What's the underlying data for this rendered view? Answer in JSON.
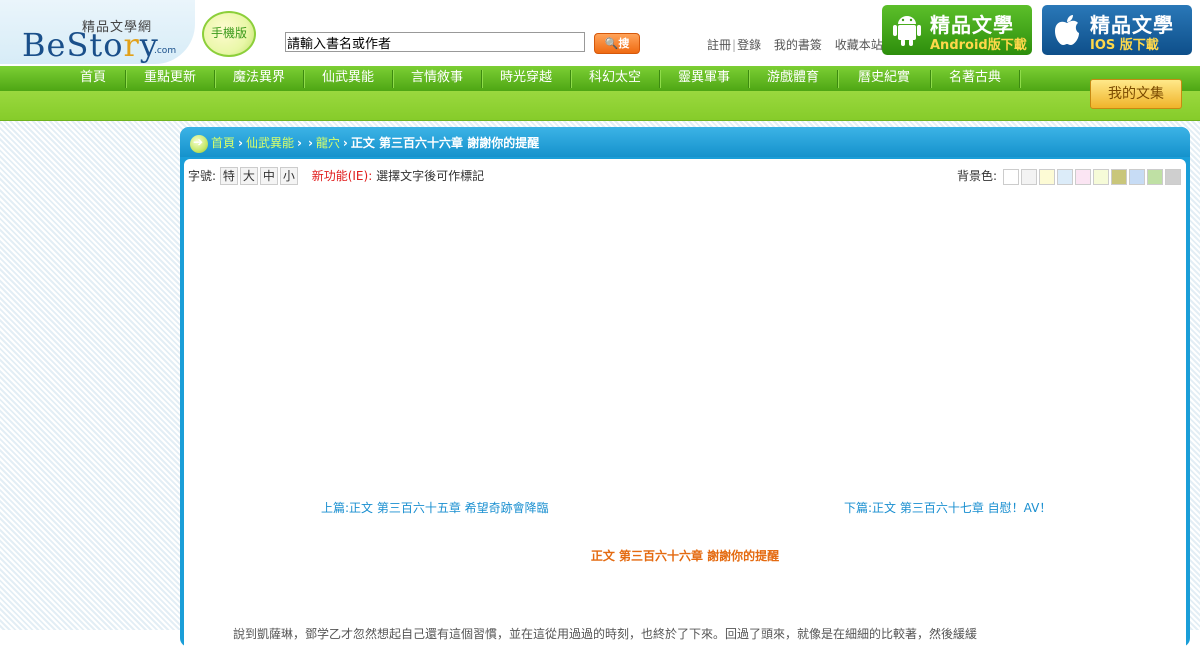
{
  "logo": {
    "small_text": "精品文學網",
    "main_before": "BeSto",
    "main_highlight": "r",
    "main_after": "y",
    "com": ".com"
  },
  "mobile_badge": "手機版",
  "search": {
    "value": "請輸入書名或作者",
    "button_label": "搜"
  },
  "toplinks": {
    "register": "註冊",
    "separator": "|",
    "login": "登錄",
    "bookshelf": "我的書簽",
    "favorite": "收藏本站"
  },
  "apps": {
    "android": {
      "title": "精品文學",
      "sub": "Android版下載",
      "icon": "android-robot-icon"
    },
    "ios": {
      "title": "精品文學",
      "sub": "IOS 版下載",
      "icon": "apple-icon"
    }
  },
  "nav": [
    "首頁",
    "重點更新",
    "魔法異界",
    "仙武異能",
    "言情敘事",
    "時光穿越",
    "科幻太空",
    "靈異軍事",
    "游戲體育",
    "曆史紀實",
    "名著古典"
  ],
  "my_books": "我的文集",
  "breadcrumb": {
    "home": "首頁",
    "category": "仙武異能",
    "book": "龍穴",
    "current": "正文 第三百六十六章 謝謝你的提醒"
  },
  "reader": {
    "font_label": "字號:",
    "font_sizes": [
      "特",
      "大",
      "中",
      "小"
    ],
    "new_feature": "新功能(IE):",
    "new_feature_desc": "選擇文字後可作標記",
    "bg_label": "背景色:",
    "bg_colors": [
      "#ffffff",
      "#f3f3f3",
      "#fdfbd5",
      "#dcecf9",
      "#fbe5f3",
      "#f6fbd8",
      "#c9c67a",
      "#c7dcf5",
      "#bfe0a4",
      "#cfcfcf"
    ]
  },
  "chapter": {
    "prev": "上篇:正文 第三百六十五章 希望奇跡會降臨",
    "next": "下篇:正文 第三百六十七章 自慰！AV！",
    "title": "正文 第三百六十六章 謝謝你的提醒",
    "first_line": "　　說到凱薩琳，鄧学乙才忽然想起自己還有這個習慣，並在這從用過過的時刻，也終於了下來。回過了頭來，就像是在細細的比較著，然後緩緩"
  }
}
